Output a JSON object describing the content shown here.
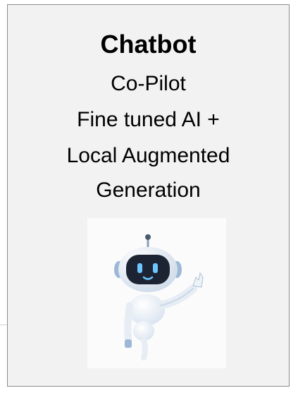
{
  "card": {
    "title": "Chatbot",
    "lines": [
      "Co-Pilot",
      "Fine tuned AI +",
      "Local Augmented",
      "Generation"
    ]
  },
  "image": {
    "icon": "robot-waving-icon",
    "colors": {
      "body": "#f7f9fc",
      "visor": "#1c2433",
      "eyes": "#6ec6ff",
      "accent": "#9dc4f0"
    }
  }
}
